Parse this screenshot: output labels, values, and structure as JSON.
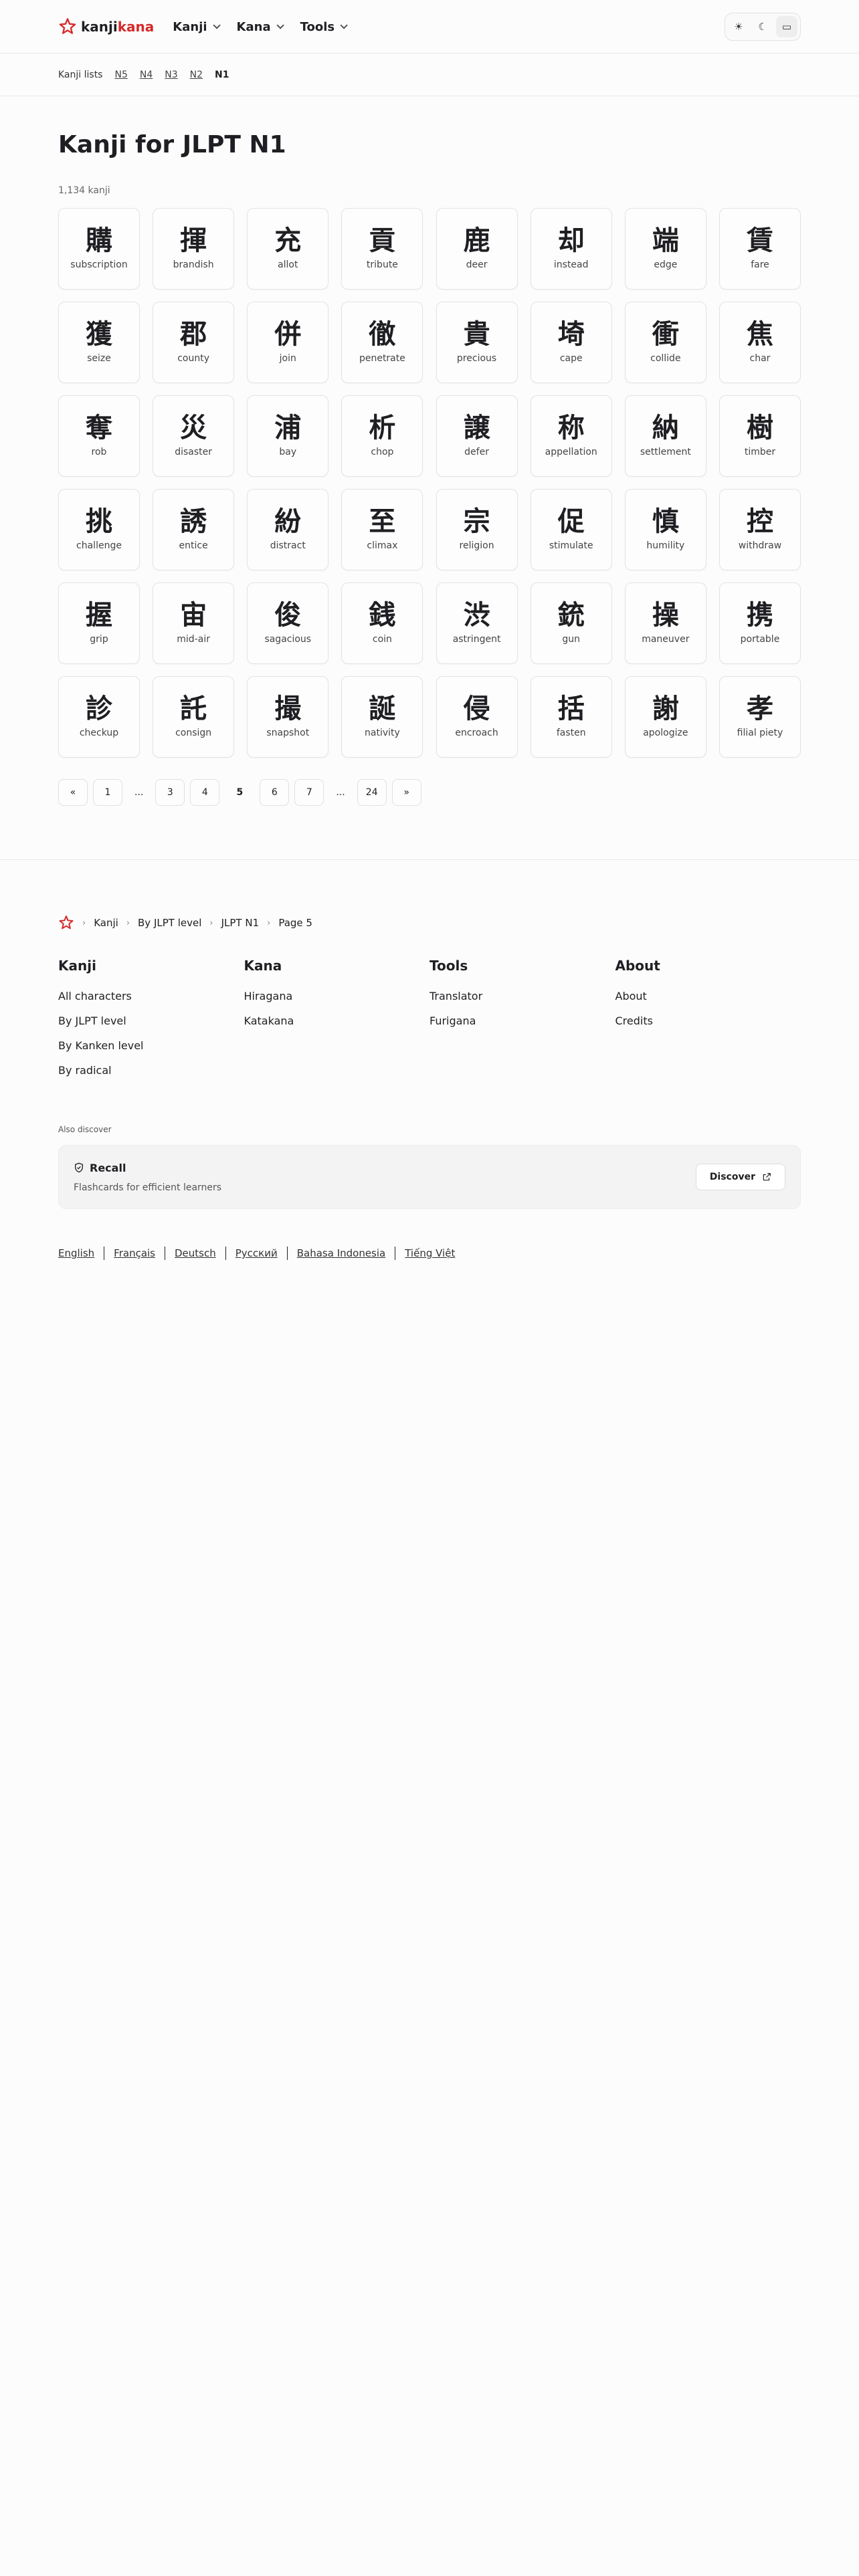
{
  "brand": {
    "part1": "kanji",
    "part2": "kana",
    "accent": "#d52a2a"
  },
  "nav": [
    {
      "label": "Kanji"
    },
    {
      "label": "Kana"
    },
    {
      "label": "Tools"
    }
  ],
  "theme": {
    "icons": [
      "sun-icon",
      "moon-icon",
      "monitor-icon"
    ],
    "light": "☀",
    "dark": "☾",
    "system": "▭"
  },
  "lists": {
    "title": "Kanji lists",
    "levels": [
      "N5",
      "N4",
      "N3",
      "N2"
    ],
    "current": "N1"
  },
  "main": {
    "title": "Kanji for JLPT N1",
    "count": "1,134 kanji"
  },
  "kanji": [
    {
      "ch": "購",
      "meaning": "subscription"
    },
    {
      "ch": "揮",
      "meaning": "brandish"
    },
    {
      "ch": "充",
      "meaning": "allot"
    },
    {
      "ch": "貢",
      "meaning": "tribute"
    },
    {
      "ch": "鹿",
      "meaning": "deer"
    },
    {
      "ch": "却",
      "meaning": "instead"
    },
    {
      "ch": "端",
      "meaning": "edge"
    },
    {
      "ch": "賃",
      "meaning": "fare"
    },
    {
      "ch": "獲",
      "meaning": "seize"
    },
    {
      "ch": "郡",
      "meaning": "county"
    },
    {
      "ch": "併",
      "meaning": "join"
    },
    {
      "ch": "徹",
      "meaning": "penetrate"
    },
    {
      "ch": "貴",
      "meaning": "precious"
    },
    {
      "ch": "埼",
      "meaning": "cape"
    },
    {
      "ch": "衝",
      "meaning": "collide"
    },
    {
      "ch": "焦",
      "meaning": "char"
    },
    {
      "ch": "奪",
      "meaning": "rob"
    },
    {
      "ch": "災",
      "meaning": "disaster"
    },
    {
      "ch": "浦",
      "meaning": "bay"
    },
    {
      "ch": "析",
      "meaning": "chop"
    },
    {
      "ch": "譲",
      "meaning": "defer"
    },
    {
      "ch": "称",
      "meaning": "appellation"
    },
    {
      "ch": "納",
      "meaning": "settlement"
    },
    {
      "ch": "樹",
      "meaning": "timber"
    },
    {
      "ch": "挑",
      "meaning": "challenge"
    },
    {
      "ch": "誘",
      "meaning": "entice"
    },
    {
      "ch": "紛",
      "meaning": "distract"
    },
    {
      "ch": "至",
      "meaning": "climax"
    },
    {
      "ch": "宗",
      "meaning": "religion"
    },
    {
      "ch": "促",
      "meaning": "stimulate"
    },
    {
      "ch": "慎",
      "meaning": "humility"
    },
    {
      "ch": "控",
      "meaning": "withdraw"
    },
    {
      "ch": "握",
      "meaning": "grip"
    },
    {
      "ch": "宙",
      "meaning": "mid-air"
    },
    {
      "ch": "俊",
      "meaning": "sagacious"
    },
    {
      "ch": "銭",
      "meaning": "coin"
    },
    {
      "ch": "渋",
      "meaning": "astringent"
    },
    {
      "ch": "銃",
      "meaning": "gun"
    },
    {
      "ch": "操",
      "meaning": "maneuver"
    },
    {
      "ch": "携",
      "meaning": "portable"
    },
    {
      "ch": "診",
      "meaning": "checkup"
    },
    {
      "ch": "託",
      "meaning": "consign"
    },
    {
      "ch": "撮",
      "meaning": "snapshot"
    },
    {
      "ch": "誕",
      "meaning": "nativity"
    },
    {
      "ch": "侵",
      "meaning": "encroach"
    },
    {
      "ch": "括",
      "meaning": "fasten"
    },
    {
      "ch": "謝",
      "meaning": "apologize"
    },
    {
      "ch": "孝",
      "meaning": "filial piety"
    }
  ],
  "pagination": {
    "first": "«",
    "p1": "1",
    "gap1": "...",
    "p3": "3",
    "p4": "4",
    "current": "5",
    "p6": "6",
    "p7": "7",
    "gap2": "...",
    "p24": "24",
    "last": "»"
  },
  "footer": {
    "breadcrumb": [
      "Kanji",
      "By JLPT level",
      "JLPT N1",
      "Page 5"
    ],
    "columns": [
      {
        "title": "Kanji",
        "links": [
          "All characters",
          "By JLPT level",
          "By Kanken level",
          "By radical"
        ]
      },
      {
        "title": "Kana",
        "links": [
          "Hiragana",
          "Katakana"
        ]
      },
      {
        "title": "Tools",
        "links": [
          "Translator",
          "Furigana"
        ]
      },
      {
        "title": "About",
        "links": [
          "About",
          "Credits"
        ]
      }
    ],
    "also": "Also discover",
    "recall": {
      "title": "Recall",
      "subtitle": "Flashcards for efficient learners",
      "button": "Discover"
    },
    "languages": [
      "English",
      "Français",
      "Deutsch",
      "Русский",
      "Bahasa Indonesia",
      "Tiếng Việt"
    ]
  }
}
